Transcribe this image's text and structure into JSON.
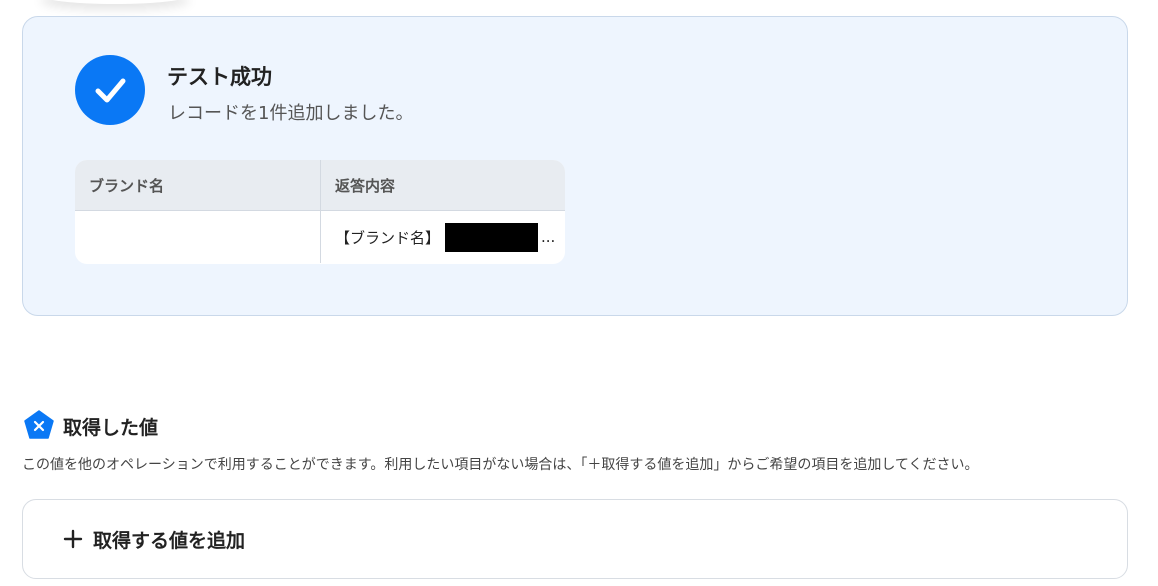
{
  "result": {
    "title": "テスト成功",
    "message": "レコードを1件追加しました。",
    "check_icon": "check-circle-icon",
    "accent_color": "#0a78f5",
    "table": {
      "headers": [
        "ブランド名",
        "返答内容"
      ],
      "rows": [
        {
          "brand": "",
          "response_prefix": "【ブランド名】",
          "response_suffix": "..."
        }
      ]
    }
  },
  "acquired": {
    "icon": "x-pentagon-icon",
    "title": "取得した値",
    "description": "この値を他のオペレーションで利用することができます。利用したい項目がない場合は、「＋取得する値を追加」からご希望の項目を追加してください。",
    "add_button_label": "取得する値を追加"
  }
}
